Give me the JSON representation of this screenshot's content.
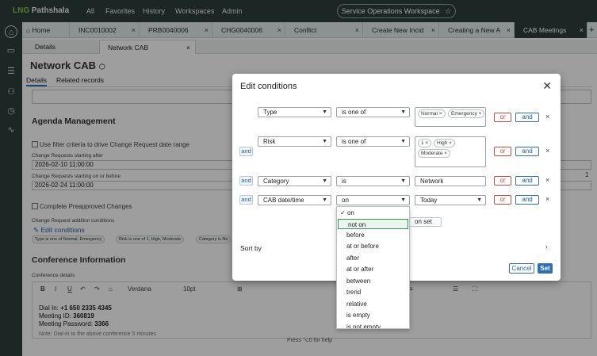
{
  "topnav": {
    "logo_prefix": "LNG",
    "logo_name": "Pathshala",
    "links": [
      "All",
      "Favorites",
      "History",
      "Workspaces",
      "Admin"
    ],
    "workspace": "Service Operations Workspace",
    "star": "☆"
  },
  "tabs": [
    {
      "label": "Home",
      "close": "×"
    },
    {
      "label": "INC0010002",
      "close": "×"
    },
    {
      "label": "PRB0040006",
      "close": "×"
    },
    {
      "label": "CHG0040006",
      "close": "×"
    },
    {
      "label": "Conflict",
      "close": "×"
    },
    {
      "label": "Create New Incid",
      "close": "×"
    },
    {
      "label": "Creating a New A",
      "close": "×"
    },
    {
      "label": "CAB Meetings",
      "close": "×"
    }
  ],
  "tab_add": "+",
  "subtabs": [
    {
      "label": "Details",
      "close": ""
    },
    {
      "label": "Network CAB",
      "close": "×"
    }
  ],
  "record": {
    "title": "Network CAB",
    "tag_icon": "⬡",
    "tabs": [
      "Details",
      "Related records"
    ]
  },
  "agenda": {
    "title": "Agenda Management",
    "use_filter": "Use filter criteria to drive Change Request date range",
    "after_label": "Change Requests starting after",
    "after_value": "2026-02-10 11:00:00",
    "before_label": "Change Requests starting on or before",
    "before_value": "2026-02-24 11:00:00",
    "complete_preapproved": "Complete Preapproved Changes",
    "addition_label": "Change Request addition conditions",
    "edit_link": "Edit conditions",
    "chips": [
      "Type is one of Normal, Emergency",
      "Risk is one of 1, High, Moderate",
      "Category is Ne"
    ],
    "side_number": "1"
  },
  "conference": {
    "title": "Conference Information",
    "details_label": "Conference details",
    "font": "Verdana",
    "size": "10pt",
    "dial_label": "Dial In:",
    "dial_value": "+1 650 2335 4345",
    "meeting_id_label": "Meeting ID:",
    "meeting_id_value": "360819",
    "password_label": "Meeting Password:",
    "password_value": "3366",
    "note": "Note: Dial-in to the above conference 5 minutes"
  },
  "status_bar": "Press ⌥0 for help",
  "modal": {
    "title": "Edit conditions",
    "close": "✕",
    "rows": [
      {
        "connector": "",
        "field": "Type",
        "op": "is one of",
        "chips": [
          "Normal",
          "Emergency"
        ],
        "value": ""
      },
      {
        "connector": "and",
        "field": "Risk",
        "op": "is one of",
        "chips": [
          "1",
          "High",
          "Moderate"
        ],
        "value": ""
      },
      {
        "connector": "and",
        "field": "Category",
        "op": "is",
        "chips": [],
        "value": "Network"
      },
      {
        "connector": "and",
        "field": "CAB date/time",
        "op": "on",
        "chips": [],
        "value": "Today"
      }
    ],
    "or_label": "or",
    "and_label": "and",
    "remove": "×",
    "new_condition_partial": "on set",
    "sort_by": "Sort by",
    "sort_chevron": "›",
    "cancel": "Cancel",
    "set": "Set"
  },
  "dropdown": {
    "items": [
      "on",
      "not on",
      "before",
      "at or before",
      "after",
      "at or after",
      "between",
      "trend",
      "relative",
      "is empty",
      "is not empty"
    ],
    "checked_index": 0,
    "highlight_index": 1
  }
}
